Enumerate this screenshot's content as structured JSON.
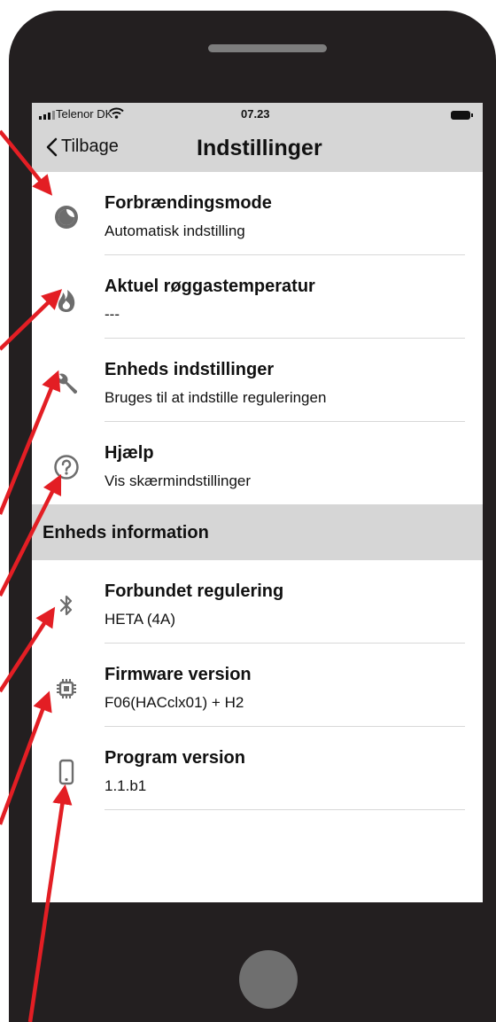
{
  "status_bar": {
    "carrier": "Telenor DK",
    "time": "07.23"
  },
  "nav": {
    "back_label": "Tilbage",
    "title": "Indstillinger"
  },
  "settings": [
    {
      "title": "Forbrændingsmode",
      "subtitle": "Automatisk indstilling",
      "icon": "half-moon-icon"
    },
    {
      "title": "Aktuel røggastemperatur",
      "subtitle": "---",
      "icon": "flame-icon"
    },
    {
      "title": "Enheds indstillinger",
      "subtitle": "Bruges til at indstille reguleringen",
      "icon": "wrench-icon"
    },
    {
      "title": "Hjælp",
      "subtitle": "Vis skærmindstillinger",
      "icon": "question-icon"
    }
  ],
  "section_header": "Enheds information",
  "info": [
    {
      "title": "Forbundet regulering",
      "subtitle": "HETA (4A)",
      "icon": "bluetooth-icon"
    },
    {
      "title": "Firmware version",
      "subtitle": "F06(HACclx01) + H2",
      "icon": "chip-icon"
    },
    {
      "title": "Program version",
      "subtitle": "1.1.b1",
      "icon": "phone-icon"
    }
  ],
  "colors": {
    "phone_body": "#231f20",
    "bar_gray": "#d6d6d6",
    "icon_gray": "#6d6d6d",
    "arrow_red": "#e31e24"
  }
}
